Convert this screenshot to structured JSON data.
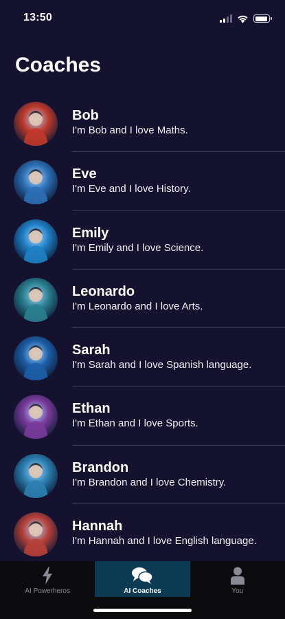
{
  "status_bar": {
    "time": "13:50"
  },
  "header": {
    "title": "Coaches"
  },
  "coaches": [
    {
      "name": "Bob",
      "description": "I'm Bob and I love Maths.",
      "avatar_color": "#c0392b"
    },
    {
      "name": "Eve",
      "description": "I'm Eve and I love History.",
      "avatar_color": "#2d6fb5"
    },
    {
      "name": "Emily",
      "description": "I'm Emily and I love Science.",
      "avatar_color": "#1f7fc4"
    },
    {
      "name": "Leonardo",
      "description": "I'm Leonardo and I love Arts.",
      "avatar_color": "#2a7f8f"
    },
    {
      "name": "Sarah",
      "description": "I'm Sarah and I love Spanish language.",
      "avatar_color": "#1d5fa8"
    },
    {
      "name": "Ethan",
      "description": "I'm Ethan and I love Sports.",
      "avatar_color": "#7a3a9a"
    },
    {
      "name": "Brandon",
      "description": "I'm Brandon and I love Chemistry.",
      "avatar_color": "#2c7fb0"
    },
    {
      "name": "Hannah",
      "description": "I'm Hannah and I love English language.",
      "avatar_color": "#b8403a"
    }
  ],
  "tab_bar": {
    "tabs": [
      {
        "label": "AI Powerheros",
        "icon": "lightning-icon",
        "active": false
      },
      {
        "label": "AI Coaches",
        "icon": "chat-bubbles-icon",
        "active": true
      },
      {
        "label": "You",
        "icon": "person-icon",
        "active": false
      }
    ]
  }
}
